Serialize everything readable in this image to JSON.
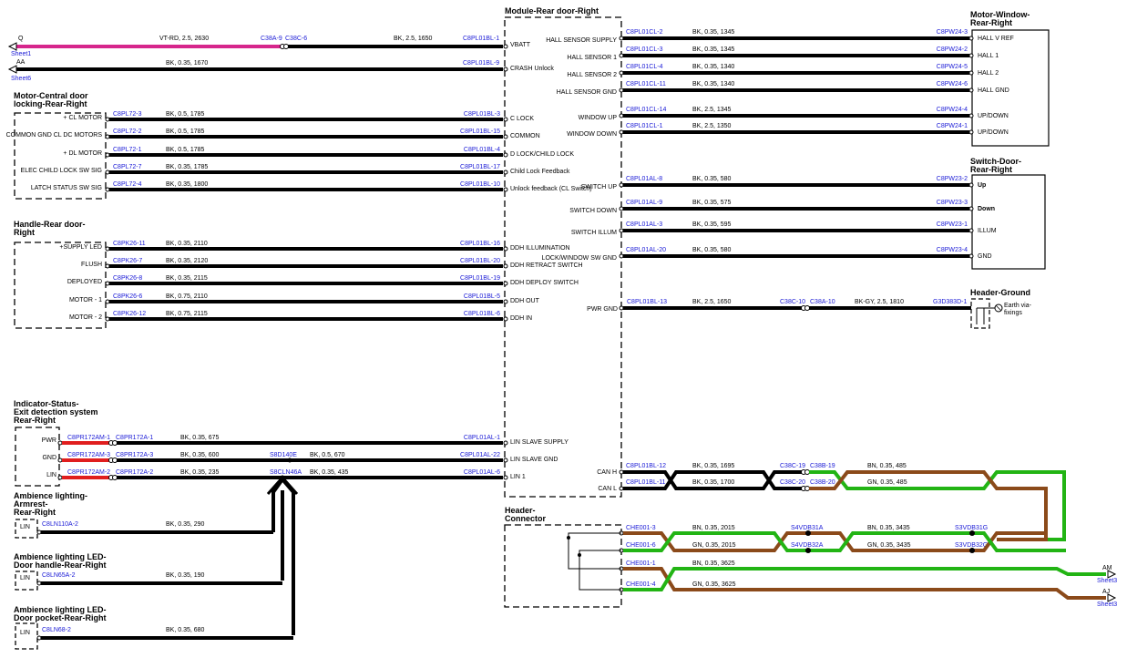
{
  "colors": {
    "black": "#000000",
    "pink": "#d6268c",
    "red": "#e01e1e",
    "green": "#22b414",
    "brown": "#8b4a1a",
    "blue": "#1a1ad6"
  },
  "module": {
    "title": "Module-Rear door-Right"
  },
  "sheet_refs": [
    {
      "id": "Q",
      "label": "Sheet1"
    },
    {
      "id": "AA",
      "label": "Sheet6"
    },
    {
      "id": "AM",
      "label": "Sheet3"
    },
    {
      "id": "AJ",
      "label": "Sheet3"
    }
  ],
  "wires_top": [
    {
      "from": "Q",
      "spec1": "VT-RD, 2.5, 2630",
      "conn1": "C38A-9",
      "conn2": "C38C-6",
      "spec2": "BK, 2.5, 1650",
      "pin": "C8PL01BL-1",
      "func": "VBATT"
    },
    {
      "from": "AA",
      "spec1": "BK, 0.35, 1670",
      "pin": "C8PL01BL-9",
      "func": "CRASH Unlock"
    }
  ],
  "left_components": [
    {
      "title1": "Motor-Central door",
      "title2": "locking-Rear-Right",
      "pins": [
        {
          "label": "+ CL MOTOR",
          "conn": "C8PL72-3",
          "spec": "BK, 0.5, 1785",
          "pin": "C8PL01BL-3",
          "func": "C LOCK"
        },
        {
          "label": "COMMON GND CL DC MOTORS",
          "conn": "C8PL72-2",
          "spec": "BK, 0.5, 1785",
          "pin": "C8PL01BL-15",
          "func": "COMMON"
        },
        {
          "label": "+ DL MOTOR",
          "conn": "C8PL72-1",
          "spec": "BK, 0.5, 1785",
          "pin": "C8PL01BL-4",
          "func": "D LOCK/CHILD LOCK"
        },
        {
          "label": "ELEC CHILD LOCK SW SIG",
          "conn": "C8PL72-7",
          "spec": "BK, 0.35, 1785",
          "pin": "C8PL01BL-17",
          "func": "Child Lock Feedback"
        },
        {
          "label": "LATCH STATUS SW SIG",
          "conn": "C8PL72-4",
          "spec": "BK, 0.35, 1800",
          "pin": "C8PL01BL-10",
          "func": "Unlock feedback (CL Switch)"
        }
      ]
    },
    {
      "title1": "Handle-Rear door-",
      "title2": "Right",
      "pins": [
        {
          "label": "+SUPPLY LED",
          "conn": "C8PK26-11",
          "spec": "BK, 0.35, 2110",
          "pin": "C8PL01BL-16",
          "func": "DDH ILLUMINATION"
        },
        {
          "label": "FLUSH",
          "conn": "C8PK26-7",
          "spec": "BK, 0.35, 2120",
          "pin": "C8PL01BL-20",
          "func": "DDH RETRACT SWITCH"
        },
        {
          "label": "DEPLOYED",
          "conn": "C8PK26-8",
          "spec": "BK, 0.35, 2115",
          "pin": "C8PL01BL-19",
          "func": "DDH DEPLOY SWITCH"
        },
        {
          "label": "MOTOR - 1",
          "conn": "C8PK26-6",
          "spec": "BK, 0.75, 2110",
          "pin": "C8PL01BL-5",
          "func": "DDH OUT"
        },
        {
          "label": "MOTOR - 2",
          "conn": "C8PK26-12",
          "spec": "BK, 0.75, 2115",
          "pin": "C8PL01BL-6",
          "func": "DDH IN"
        }
      ]
    }
  ],
  "indicator": {
    "title1": "Indicator-Status-",
    "title2": "Exit detection system",
    "title3": "Rear-Right",
    "pins": [
      {
        "label": "PWR",
        "conn": "C8PR172AM-1",
        "conn2": "C8PR172A-1",
        "spec": "BK, 0.35, 675",
        "pin": "C8PL01AL-1",
        "func": "LIN SLAVE SUPPLY"
      },
      {
        "label": "GND",
        "conn": "C8PR172AM-3",
        "conn2": "C8PR172A-3",
        "spec": "BK, 0.35, 600",
        "splice": "S8D140E",
        "spec2": "BK, 0.5, 670",
        "pin": "C8PL01AL-22",
        "func": "LIN SLAVE GND"
      },
      {
        "label": "LIN",
        "conn": "C8PR172AM-2",
        "conn2": "C8PR172A-2",
        "spec": "BK, 0.35, 235",
        "splice": "S8CLN46A",
        "spec2": "BK, 0.35, 435",
        "pin": "C8PL01AL-6",
        "func": "LIN 1"
      }
    ]
  },
  "ambience": [
    {
      "title1": "Ambience lighting-",
      "title2": "Armrest-",
      "title3": "Rear-Right",
      "pinlabel": "LIN",
      "conn": "C8LN110A-2",
      "spec": "BK, 0.35, 290"
    },
    {
      "title1": "Ambience lighting LED-",
      "title2": "Door handle-Rear-Right",
      "pinlabel": "LIN",
      "conn": "C8LN65A-2",
      "spec": "BK, 0.35, 190"
    },
    {
      "title1": "Ambience lighting LED-",
      "title2": "Door pocket-Rear-Right",
      "pinlabel": "LIN",
      "conn": "C8LN68-2",
      "spec": "BK, 0.35, 680"
    }
  ],
  "motor_window": {
    "title1": "Motor-Window-",
    "title2": "Rear-Right",
    "pins": [
      {
        "func": "HALL SENSOR SUPPLY",
        "pin": "C8PL01CL-2",
        "spec": "BK, 0.35, 1345",
        "conn": "C8PW24-3",
        "label": "HALL V REF"
      },
      {
        "func": "HALL SENSOR 1",
        "pin": "C8PL01CL-3",
        "spec": "BK, 0.35, 1345",
        "conn": "C8PW24-2",
        "label": "HALL 1"
      },
      {
        "func": "HALL SENSOR 2",
        "pin": "C8PL01CL-4",
        "spec": "BK, 0.35, 1340",
        "conn": "C8PW24-5",
        "label": "HALL 2"
      },
      {
        "func": "HALL SENSOR GND",
        "pin": "C8PL01CL-11",
        "spec": "BK, 0.35, 1340",
        "conn": "C8PW24-6",
        "label": "HALL GND"
      },
      {
        "func": "WINDOW UP",
        "pin": "C8PL01CL-14",
        "spec": "BK, 2.5, 1345",
        "conn": "C8PW24-4",
        "label": "UP/DOWN"
      },
      {
        "func": "WINDOW DOWN",
        "pin": "C8PL01CL-1",
        "spec": "BK, 2.5, 1350",
        "conn": "C8PW24-1",
        "label": "UP/DOWN"
      }
    ]
  },
  "switch_door": {
    "title1": "Switch-Door-",
    "title2": "Rear-Right",
    "pins": [
      {
        "func": "SWITCH UP",
        "pin": "C8PL01AL-8",
        "spec": "BK, 0.35, 580",
        "conn": "C8PW23-2",
        "label": "Up"
      },
      {
        "func": "SWITCH DOWN",
        "pin": "C8PL01AL-9",
        "spec": "BK, 0.35, 575",
        "conn": "C8PW23-3",
        "label": "Down"
      },
      {
        "func": "SWITCH ILLUM",
        "pin": "C8PL01AL-3",
        "spec": "BK, 0.35, 595",
        "conn": "C8PW23-1",
        "label": "ILLUM"
      },
      {
        "func": "LOCK/WINDOW SW GND",
        "pin": "C8PL01AL-20",
        "spec": "BK, 0.35, 580",
        "conn": "C8PW23-4",
        "label": "GND"
      }
    ]
  },
  "ground": {
    "title": "Header-Ground",
    "func": "PWR GND",
    "pin": "C8PL01BL-13",
    "spec1": "BK, 2.5, 1650",
    "conn1": "C38C-10",
    "conn2": "C38A-10",
    "spec2": "BK-GY, 2.5, 1810",
    "conn3": "G3D383D-1",
    "earth1": "Earth via-",
    "earth2": "fixings"
  },
  "can": {
    "h": {
      "func": "CAN H",
      "pin": "C8PL01BL-12",
      "spec1": "BK, 0.35, 1695",
      "conn1": "C38C-19",
      "conn2": "C38B-19",
      "spec2": "BN, 0.35, 485"
    },
    "l": {
      "func": "CAN L",
      "pin": "C8PL01BL-11",
      "spec1": "BK, 0.35, 1700",
      "conn1": "C38C-20",
      "conn2": "C38B-20",
      "spec2": "GN, 0.35, 485"
    }
  },
  "header_connector": {
    "title1": "Header-",
    "title2": "Connector",
    "rows": [
      {
        "pin": "CHE001-3",
        "spec1": "BN, 0.35, 2015",
        "splice1": "S4VDB31A",
        "spec2": "BN, 0.35, 3435",
        "splice2": "S3VDB31G"
      },
      {
        "pin": "CHE001-6",
        "spec1": "GN, 0.35, 2015",
        "splice1": "S4VDB32A",
        "spec2": "GN, 0.35, 3435",
        "splice2": "S3VDB32G"
      },
      {
        "pin": "CHE001-1",
        "spec1": "BN, 0.35, 3625"
      },
      {
        "pin": "CHE001-4",
        "spec1": "GN, 0.35, 3625"
      }
    ]
  }
}
